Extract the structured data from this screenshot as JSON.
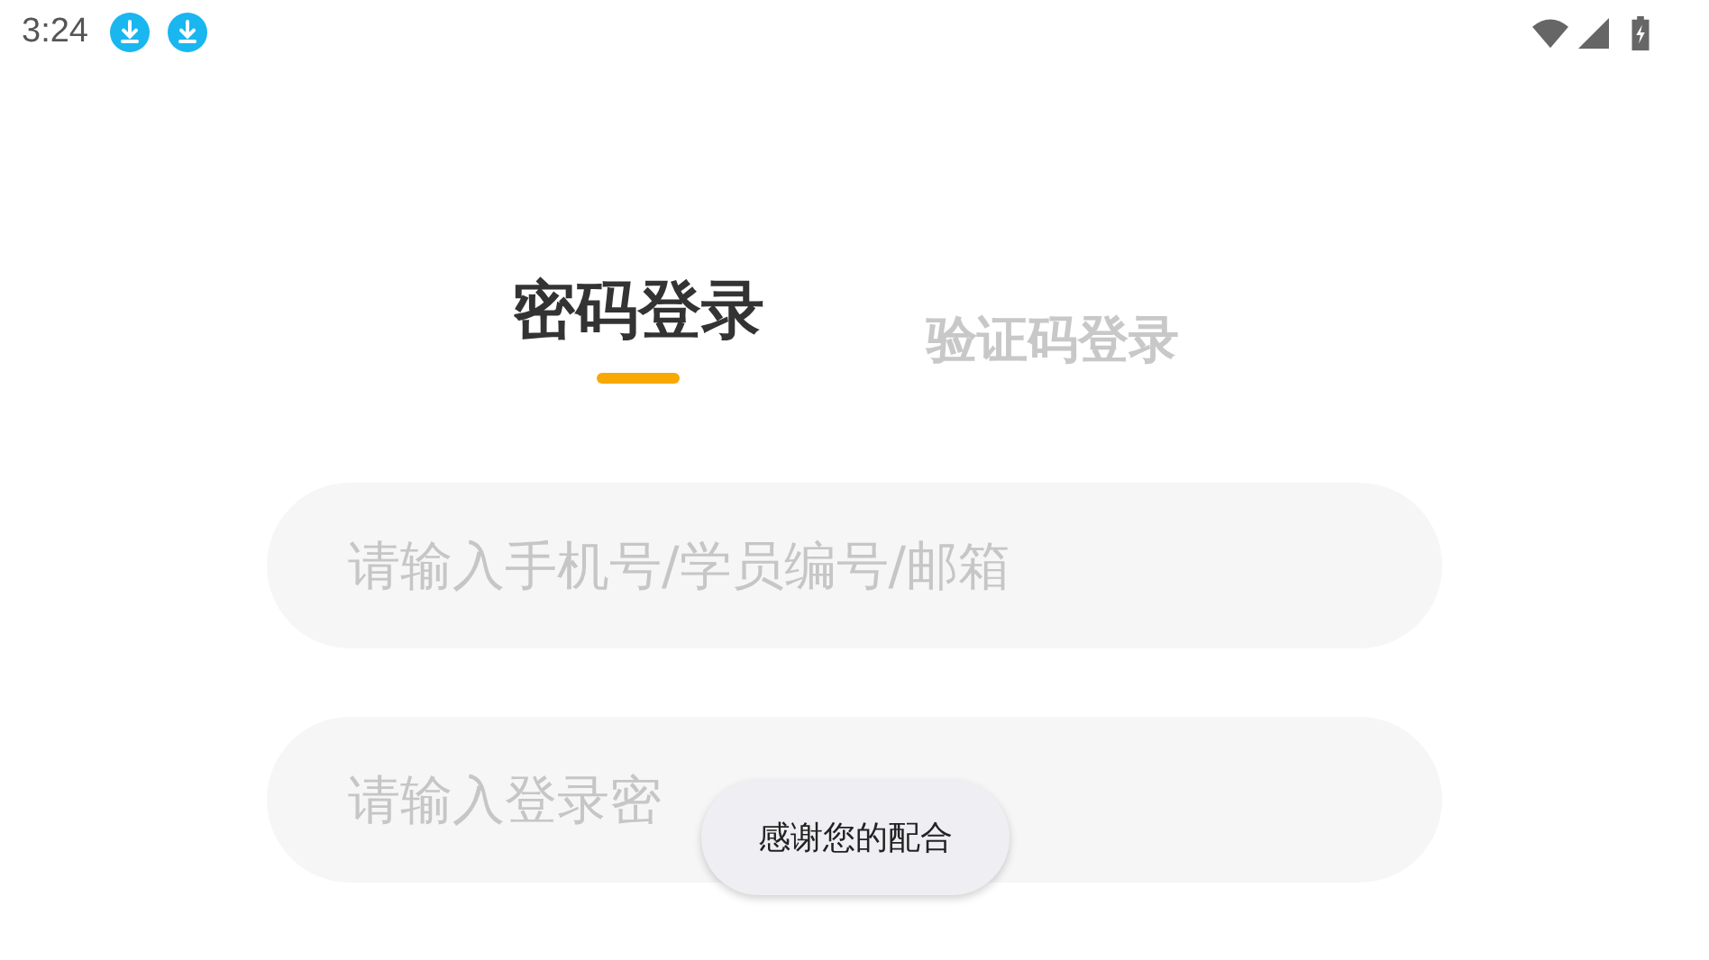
{
  "status_bar": {
    "time": "3:24",
    "notifications": [
      {
        "kind": "download"
      },
      {
        "kind": "download"
      }
    ]
  },
  "tabs": [
    {
      "label": "密码登录",
      "selected": true
    },
    {
      "label": "验证码登录",
      "selected": false
    }
  ],
  "fields": [
    {
      "placeholder": "请输入手机号/学员编号/邮箱"
    },
    {
      "placeholder": "请输入登录密"
    }
  ],
  "toast": "感谢您的配合"
}
